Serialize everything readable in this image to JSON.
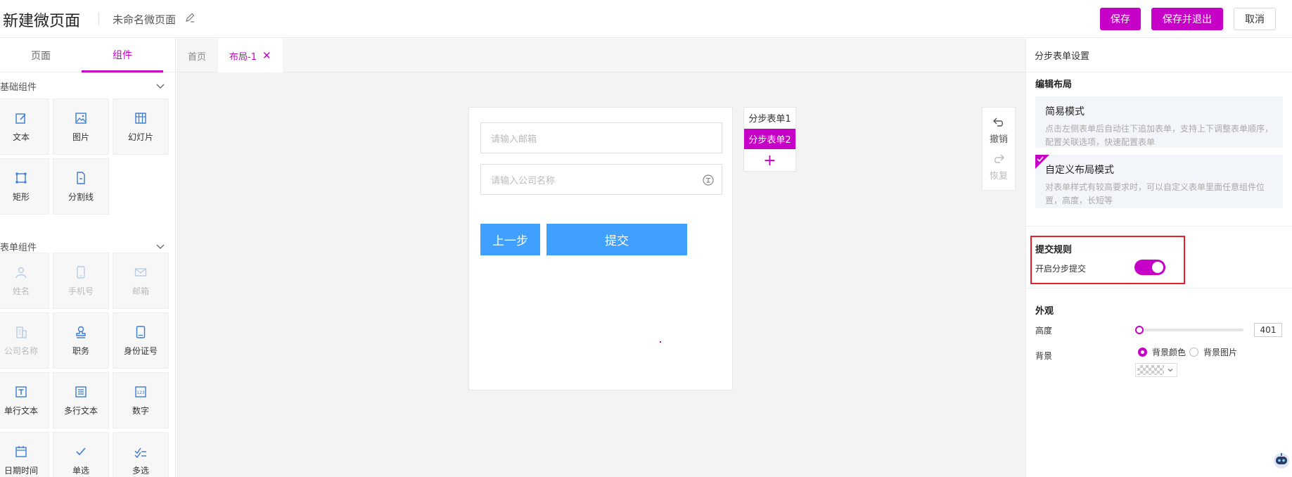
{
  "header": {
    "title": "新建微页面",
    "page_name": "未命名微页面",
    "buttons": {
      "save": "保存",
      "save_exit": "保存并退出",
      "cancel": "取消"
    }
  },
  "left": {
    "tabs": [
      "页面",
      "组件"
    ],
    "active_tab": "组件",
    "basic_group": {
      "title": "基础组件",
      "items": [
        {
          "label": "文本",
          "icon": "edit-icon"
        },
        {
          "label": "图片",
          "icon": "image-icon"
        },
        {
          "label": "幻灯片",
          "icon": "slideshow-icon"
        },
        {
          "label": "矩形",
          "icon": "rectangle-icon"
        },
        {
          "label": "分割线",
          "icon": "divider-doc-icon"
        }
      ]
    },
    "form_group": {
      "title": "表单组件",
      "items": [
        {
          "label": "姓名",
          "icon": "person-icon",
          "disabled": true
        },
        {
          "label": "手机号",
          "icon": "phone-icon",
          "disabled": true
        },
        {
          "label": "邮箱",
          "icon": "mail-icon",
          "disabled": true
        },
        {
          "label": "公司名称",
          "icon": "building-icon",
          "disabled": true
        },
        {
          "label": "职务",
          "icon": "stamp-icon",
          "disabled": false
        },
        {
          "label": "身份证号",
          "icon": "id-card-icon",
          "disabled": false
        },
        {
          "label": "单行文本",
          "icon": "text-icon",
          "disabled": false
        },
        {
          "label": "多行文本",
          "icon": "multiline-text-icon",
          "disabled": false
        },
        {
          "label": "数字",
          "icon": "number-icon",
          "disabled": false
        },
        {
          "label": "日期时间",
          "icon": "calendar-icon",
          "disabled": false
        },
        {
          "label": "单选",
          "icon": "check-icon",
          "disabled": false
        },
        {
          "label": "多选",
          "icon": "multi-check-icon",
          "disabled": false
        }
      ]
    }
  },
  "doc_tabs": [
    {
      "label": "首页",
      "active": false
    },
    {
      "label": "布局-1",
      "active": true
    }
  ],
  "canvas": {
    "email_placeholder": "请输入邮箱",
    "company_placeholder": "请输入公司名称",
    "prev_button": "上一步",
    "submit_button": "提交",
    "steps": [
      "分步表单1",
      "分步表单2"
    ],
    "active_step": 1,
    "add_step": "+",
    "undo": "撤销",
    "redo": "恢复"
  },
  "right": {
    "header": "分步表单设置",
    "layout_section": "编辑布局",
    "simple_mode": {
      "title": "简易模式",
      "desc": "点击左侧表单后自动往下追加表单，支持上下调整表单顺序，配置关联选项，快速配置表单"
    },
    "custom_mode": {
      "title": "自定义布局模式",
      "desc": "对表单样式有较高要求时，可以自定义表单里面任意组件位置，高度，长短等",
      "selected": true
    },
    "submit_section": "提交规则",
    "step_submit_label": "开启分步提交",
    "step_submit_on": true,
    "appearance_section": "外观",
    "height_label": "高度",
    "height_value": "401",
    "background_label": "背景",
    "bg_color_label": "背景颜色",
    "bg_image_label": "背景图片",
    "bg_mode": "color"
  },
  "colors": {
    "accent": "#c700c7",
    "button_blue": "#3fa0ff",
    "highlight": "#e8202a",
    "card_bg": "#f2f6fb"
  }
}
